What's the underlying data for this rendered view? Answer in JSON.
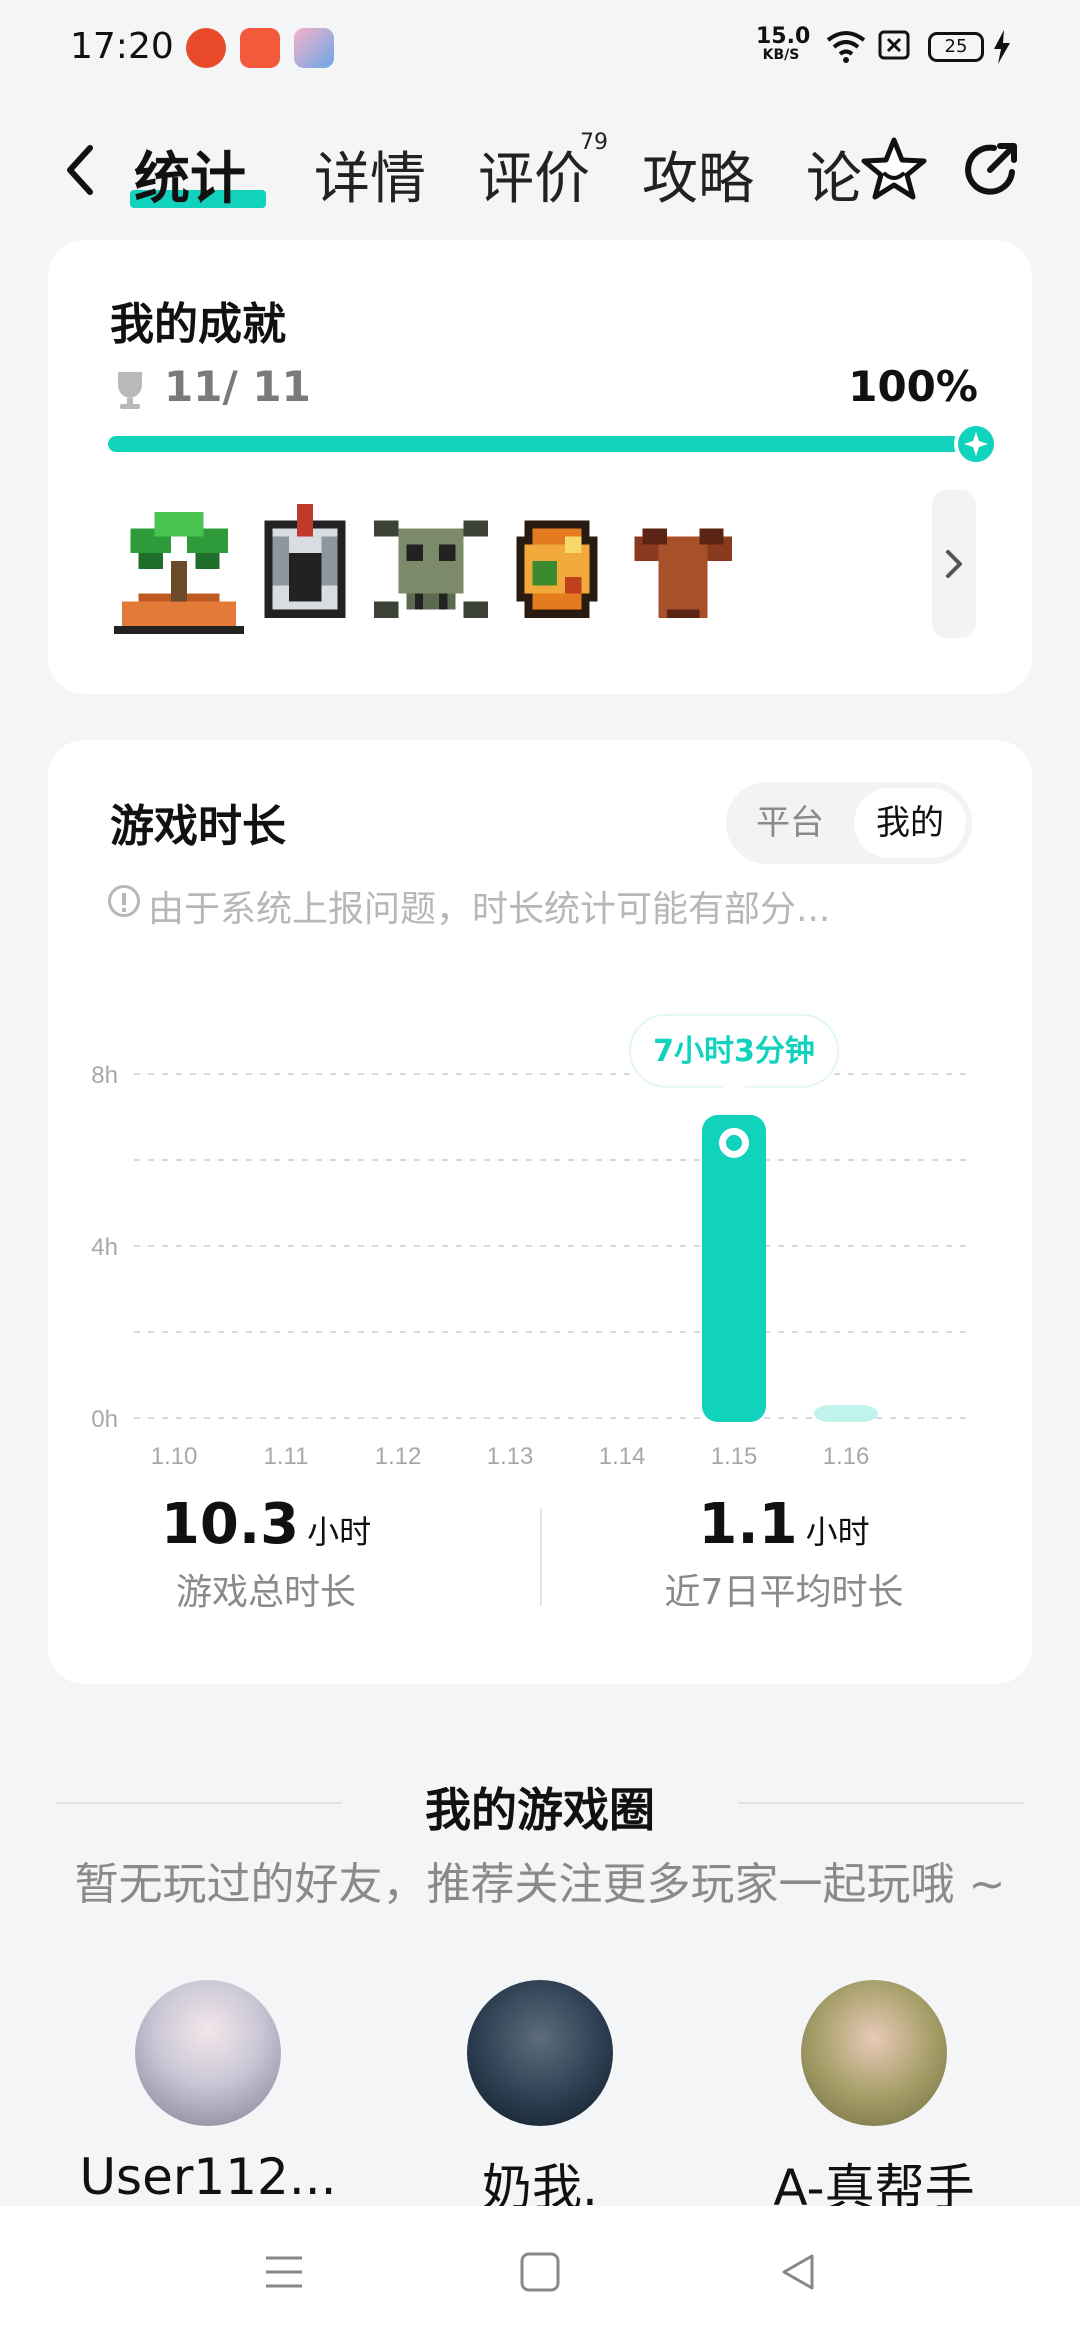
{
  "status_bar": {
    "time": "17:20",
    "net_speed_value": "15.0",
    "net_speed_unit": "KB/S",
    "battery": "25",
    "icons": [
      "notification-app-icon",
      "video-app-icon",
      "anime-app-icon",
      "wifi-icon",
      "sim-off-icon",
      "battery-icon",
      "charging-icon"
    ]
  },
  "nav": {
    "tabs": [
      {
        "label": "统计",
        "active": true
      },
      {
        "label": "详情"
      },
      {
        "label": "评价"
      },
      {
        "label": "攻略"
      },
      {
        "label": "论"
      }
    ],
    "review_count": "79",
    "accent": "#11d3bd",
    "icons": [
      "back-icon",
      "star-icon",
      "share-icon"
    ]
  },
  "achievements": {
    "title": "我的成就",
    "count": "11/ 11",
    "percent": "100%",
    "progress": 1.0,
    "badges": [
      "plant-badge",
      "helmet-badge",
      "skull-badge",
      "orb-badge",
      "tunic-badge"
    ]
  },
  "playtime": {
    "title": "游戏时长",
    "toggle": {
      "platform": "平台",
      "mine": "我的",
      "selected": "我的"
    },
    "notice": "由于系统上报问题，时长统计可能有部分...",
    "tooltip": "7小时3分钟",
    "total_value": "10.3",
    "total_unit": "小时",
    "total_label": "游戏总时长",
    "avg_value": "1.1",
    "avg_unit": "小时",
    "avg_label": "近7日平均时长"
  },
  "chart_data": {
    "type": "bar",
    "categories": [
      "1.10",
      "1.11",
      "1.12",
      "1.13",
      "1.14",
      "1.15",
      "1.16"
    ],
    "values": [
      0,
      0,
      0,
      0,
      0,
      7.05,
      0.3
    ],
    "ylim": [
      0,
      8
    ],
    "yticks": [
      "0h",
      "4h",
      "8h"
    ],
    "grid": true,
    "highlighted_category": "1.15",
    "bar_color": "#11d3bd",
    "bar_color_light": "#bff3ec"
  },
  "game_circle": {
    "title": "我的游戏圈",
    "subtitle": "暂无玩过的好友，推荐关注更多玩家一起玩哦 ~",
    "users": [
      {
        "name": "User112..."
      },
      {
        "name": "奶我."
      },
      {
        "name": "A-真帮手"
      }
    ]
  },
  "system_nav": {
    "icons": [
      "menu-icon",
      "home-icon",
      "back-triangle-icon"
    ]
  }
}
